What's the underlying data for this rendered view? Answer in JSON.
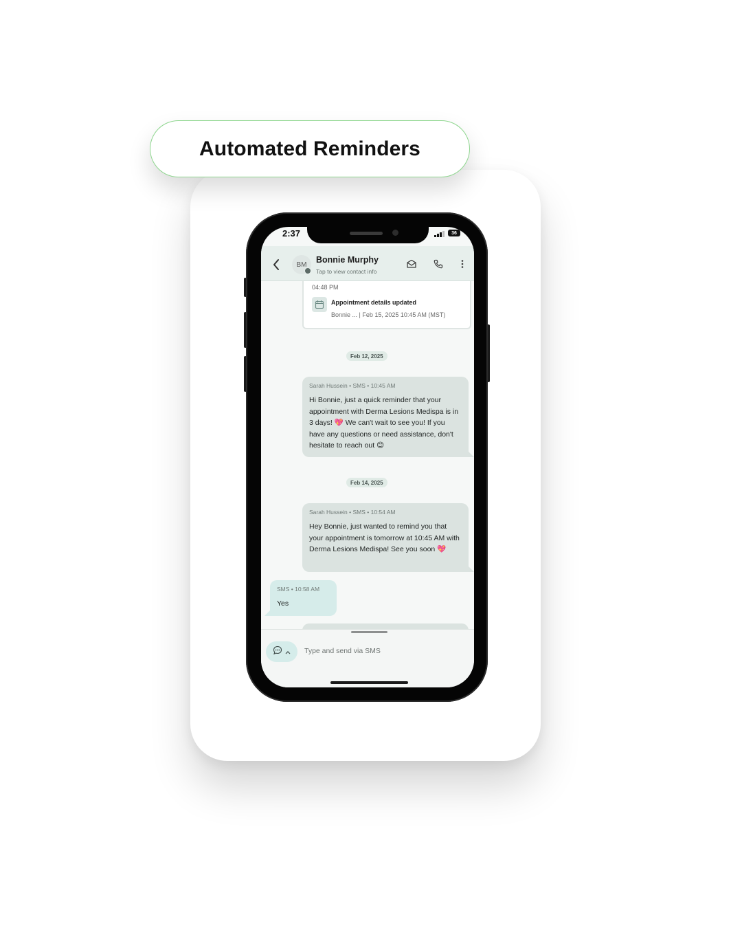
{
  "banner": {
    "title": "Automated Reminders"
  },
  "status_bar": {
    "time": "2:37",
    "battery": "36"
  },
  "header": {
    "avatar_initials": "BM",
    "contact_name": "Bonnie Murphy",
    "subtitle": "Tap to view contact info",
    "icons": [
      "back-chevron-icon",
      "email-icon",
      "phone-icon",
      "more-vertical-icon"
    ]
  },
  "appointment_card": {
    "time": "04:48 PM",
    "title": "Appointment details updated",
    "detail": "Bonnie ... | Feb 15, 2025 10:45 AM (MST)"
  },
  "messages": [
    {
      "type": "date",
      "label": "Feb 12, 2025"
    },
    {
      "type": "outgoing",
      "sender": "Sarah Hussein",
      "channel": "SMS",
      "time": "10:45 AM",
      "text": "Hi Bonnie, just a quick reminder that your appointment with Derma Lesions Medispa is in 3 days! 💖  We can't wait to see you! If you have any questions or need assistance, don't hesitate to reach out 😊"
    },
    {
      "type": "date",
      "label": "Feb 14, 2025"
    },
    {
      "type": "outgoing",
      "sender": "Sarah Hussein",
      "channel": "SMS",
      "time": "10:54 AM",
      "text": "Hey Bonnie, just wanted to remind you that your appointment is tomorrow at 10:45 AM with Derma Lesions Medispa! See you soon 💖"
    },
    {
      "type": "incoming",
      "channel": "SMS",
      "time": "10:58 AM",
      "text": "Yes"
    }
  ],
  "composer": {
    "placeholder": "Type and send via SMS"
  },
  "colors": {
    "accent_border": "#8ed68e",
    "header_bg": "#e7efec",
    "outgoing_bubble": "#dbe3e0",
    "incoming_bubble": "#d6ecea",
    "date_chip": "#e0ebe6"
  }
}
